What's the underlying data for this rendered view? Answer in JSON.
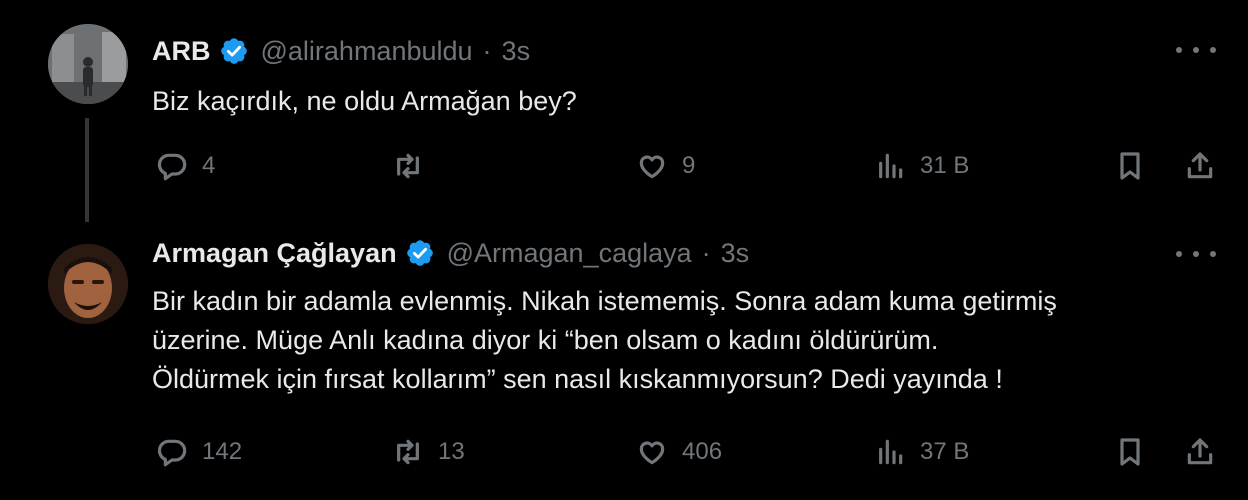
{
  "tweets": [
    {
      "author_name": "ARB",
      "handle": "@alirahmanbuldu",
      "separator": "·",
      "time": "3s",
      "text_lines": [
        "Biz kaçırdık, ne oldu Armağan bey?"
      ],
      "replies": "4",
      "retweets": "",
      "likes": "9",
      "views": "31 B"
    },
    {
      "author_name": "Armagan Çağlayan",
      "handle": "@Armagan_caglaya",
      "separator": "·",
      "time": "3s",
      "text_lines": [
        "Bir kadın bir adamla evlenmiş. Nikah istememiş. Sonra adam kuma getirmiş",
        "üzerine. Müge Anlı kadına diyor ki “ben olsam o kadını öldürürüm.",
        "Öldürmek için  fırsat kollarım” sen nasıl kıskanmıyorsun? Dedi yayında !"
      ],
      "replies": "142",
      "retweets": "13",
      "likes": "406",
      "views": "37 B"
    }
  ],
  "icons": {
    "verified": "verified-badge-icon",
    "more": "more-options-icon",
    "reply": "reply-icon",
    "retweet": "retweet-icon",
    "like": "heart-icon",
    "views": "views-chart-icon",
    "bookmark": "bookmark-icon",
    "share": "share-icon"
  },
  "colors": {
    "background": "#000000",
    "text": "#e7e9ea",
    "secondary": "#71767b",
    "verified": "#1d9bf0",
    "thread_line": "#333639"
  }
}
